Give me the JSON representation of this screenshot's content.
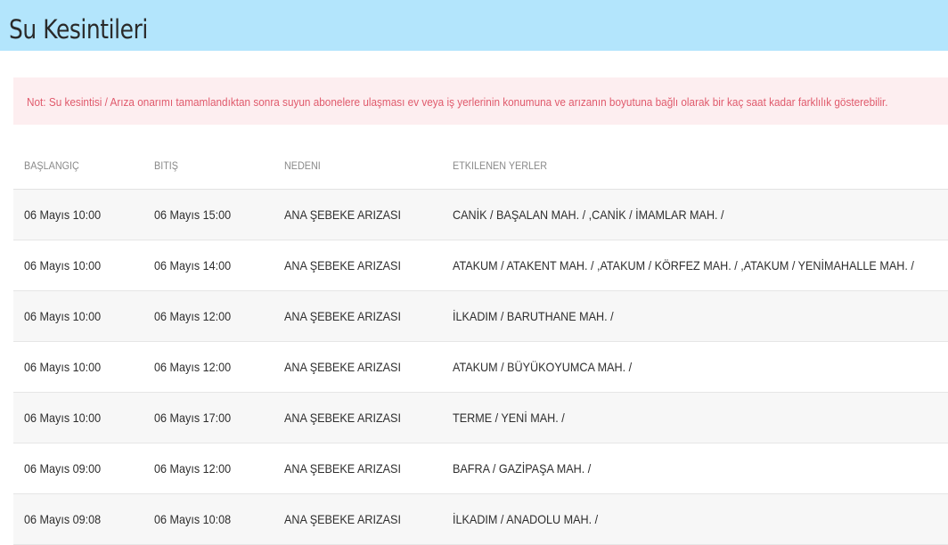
{
  "header": {
    "title": "Su Kesintileri"
  },
  "notice": "Not: Su kesintisi / Arıza onarımı tamamlandıktan sonra suyun abonelere ulaşması ev veya iş yerlerinin konumuna ve arızanın boyutuna bağlı olarak bir kaç saat kadar farklılık gösterebilir.",
  "table": {
    "columns": [
      "BAŞLANGIÇ",
      "BITIŞ",
      "NEDENI",
      "ETKILENEN YERLER"
    ],
    "rows": [
      [
        "06 Mayıs 10:00",
        "06 Mayıs 15:00",
        "ANA ŞEBEKE ARIZASI",
        "CANİK / BAŞALAN MAH. / ,CANİK / İMAMLAR MAH. /"
      ],
      [
        "06 Mayıs 10:00",
        "06 Mayıs 14:00",
        "ANA ŞEBEKE ARIZASI",
        "ATAKUM / ATAKENT MAH. / ,ATAKUM / KÖRFEZ MAH. / ,ATAKUM / YENİMAHALLE MAH. /"
      ],
      [
        "06 Mayıs 10:00",
        "06 Mayıs 12:00",
        "ANA ŞEBEKE ARIZASI",
        "İLKADIM / BARUTHANE MAH. /"
      ],
      [
        "06 Mayıs 10:00",
        "06 Mayıs 12:00",
        "ANA ŞEBEKE ARIZASI",
        "ATAKUM / BÜYÜKOYUMCA MAH. /"
      ],
      [
        "06 Mayıs 10:00",
        "06 Mayıs 17:00",
        "ANA ŞEBEKE ARIZASI",
        "TERME / YENİ MAH. /"
      ],
      [
        "06 Mayıs 09:00",
        "06 Mayıs 12:00",
        "ANA ŞEBEKE ARIZASI",
        "BAFRA / GAZİPAŞA MAH. /"
      ],
      [
        "06 Mayıs 09:08",
        "06 Mayıs 10:08",
        "ANA ŞEBEKE ARIZASI",
        "İLKADIM / ANADOLU MAH. /"
      ]
    ]
  }
}
